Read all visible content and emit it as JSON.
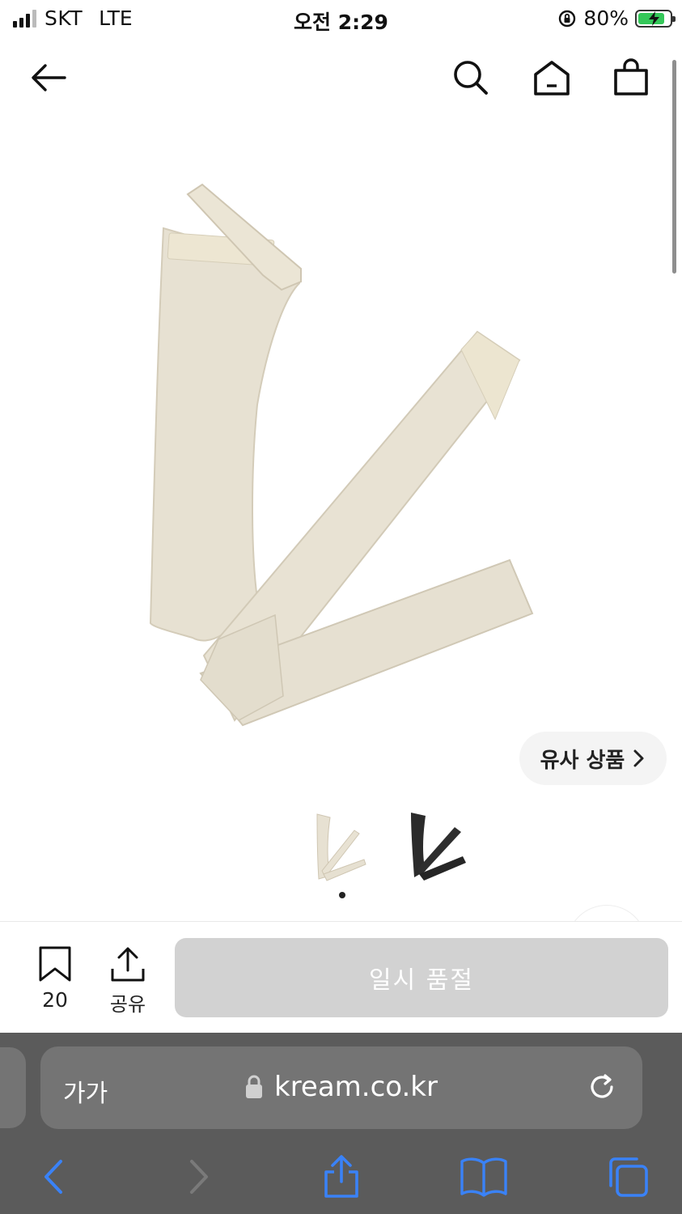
{
  "status_bar": {
    "carrier": "SKT",
    "network": "LTE",
    "time": "오전 2:29",
    "battery": "80%",
    "battery_level": 0.8,
    "icons": [
      "signal-icon",
      "orientation-lock-icon",
      "battery-charging-icon"
    ]
  },
  "nav": {
    "icons": [
      "back-arrow-icon",
      "search-icon",
      "home-icon",
      "shopping-bag-icon"
    ]
  },
  "product": {
    "similar_label": "유사 상품",
    "color_options": [
      "beige",
      "black"
    ],
    "selected_option_index": 0,
    "colors": {
      "beige": "#e9e4d6",
      "black": "#2b2b2b"
    }
  },
  "actions": {
    "bookmark_count": "20",
    "share_label": "공유",
    "soldout_label": "일시 품절"
  },
  "browser": {
    "text_size_label": "가가",
    "url": "kream.co.kr",
    "toolbar_icons": [
      "back-icon",
      "forward-icon",
      "share-icon",
      "bookmarks-icon",
      "tabs-icon"
    ],
    "accent": "#3a82f7"
  }
}
